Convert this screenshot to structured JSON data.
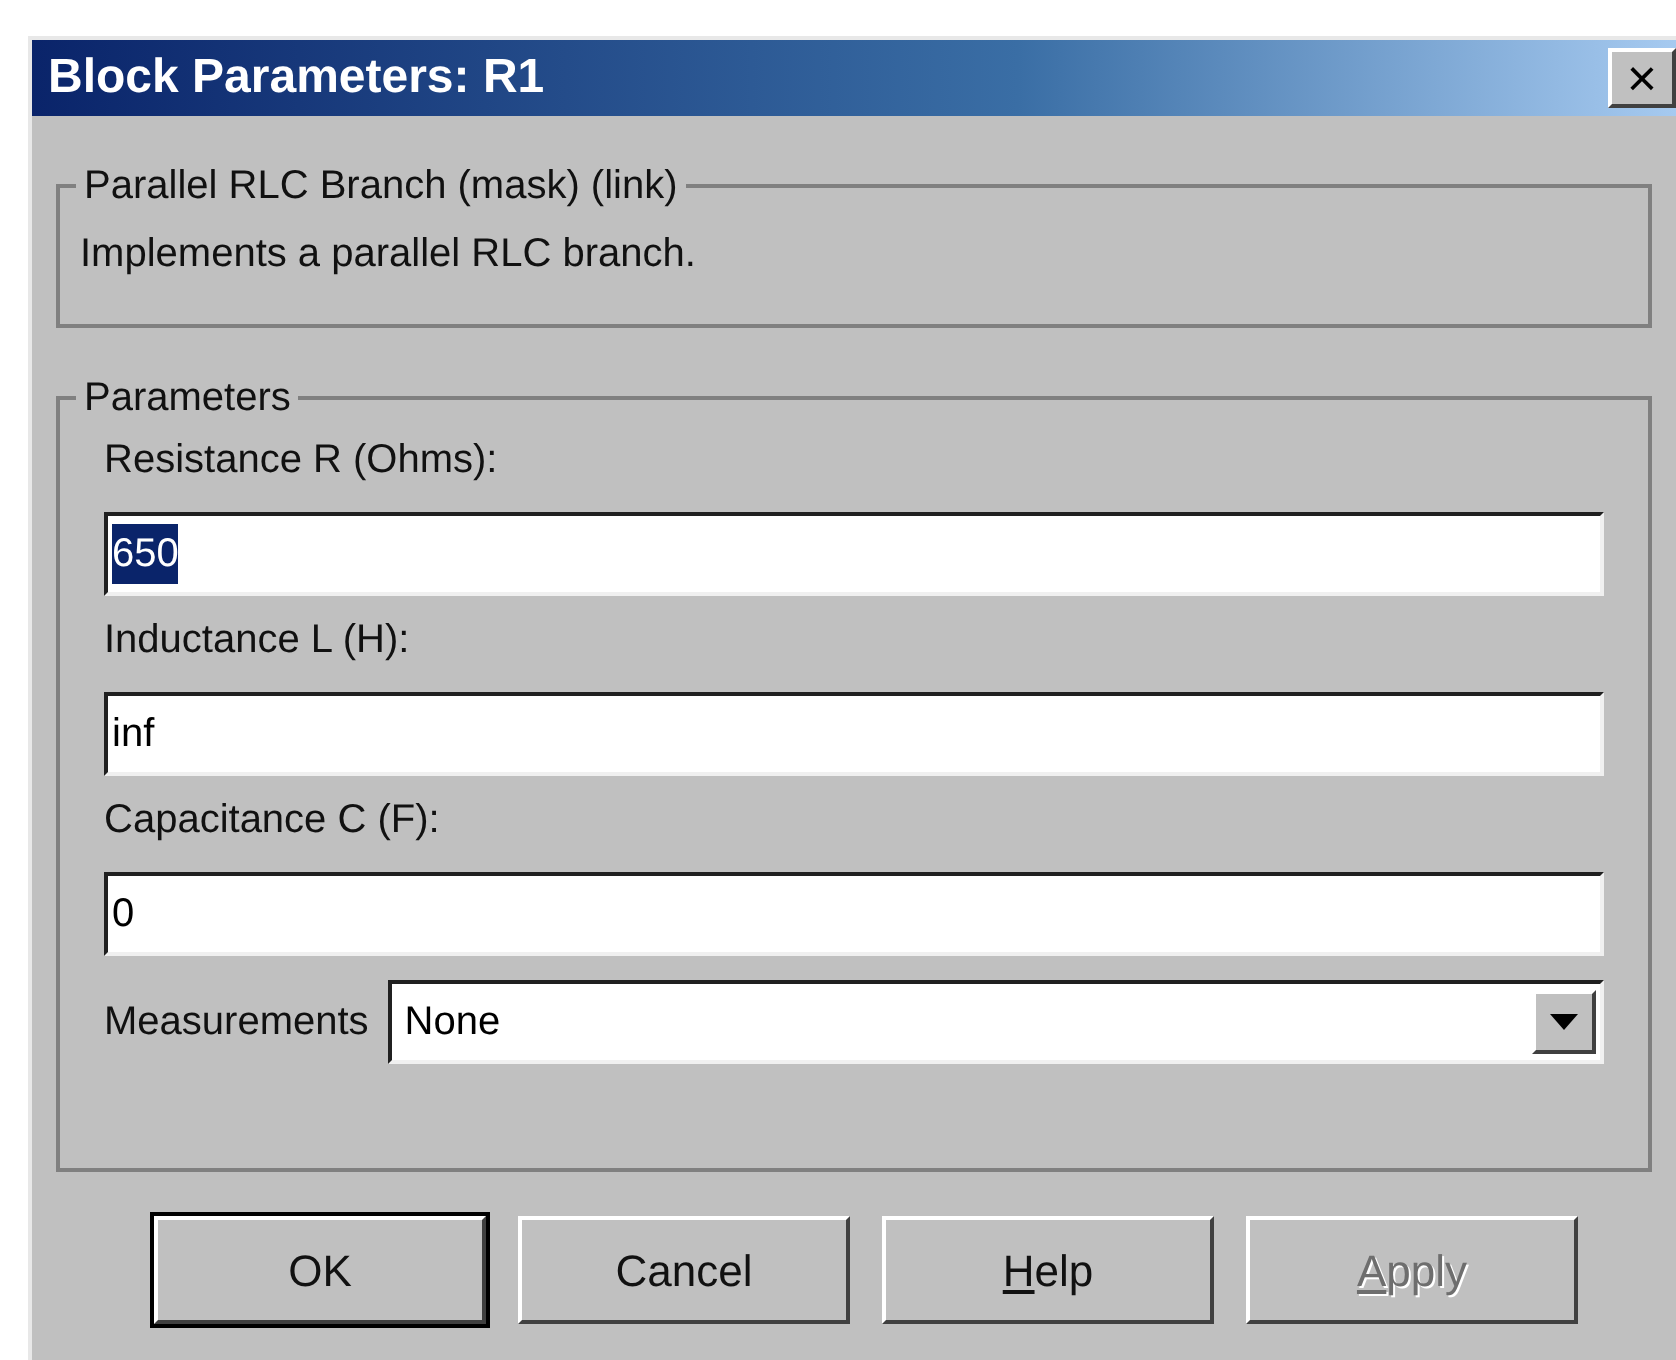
{
  "window": {
    "title": "Block Parameters: R1",
    "close": "×"
  },
  "description_group": {
    "title": "Parallel RLC Branch (mask) (link)",
    "text": "Implements a parallel RLC branch."
  },
  "parameters_group": {
    "title": "Parameters",
    "fields": [
      {
        "label": "Resistance R (Ohms):",
        "value": "650",
        "selected": true
      },
      {
        "label": "Inductance L (H):",
        "value": "inf",
        "selected": false
      },
      {
        "label": "Capacitance C (F):",
        "value": "0",
        "selected": false
      }
    ],
    "measurements": {
      "label": "Measurements",
      "value": "None"
    }
  },
  "buttons": [
    {
      "label": "OK",
      "default": true,
      "disabled": false,
      "accelerator": false
    },
    {
      "label": "Cancel",
      "default": false,
      "disabled": false,
      "accelerator": false
    },
    {
      "label": "Help",
      "default": false,
      "disabled": false,
      "accelerator": true
    },
    {
      "label": "Apply",
      "default": false,
      "disabled": true,
      "accelerator": true
    }
  ]
}
